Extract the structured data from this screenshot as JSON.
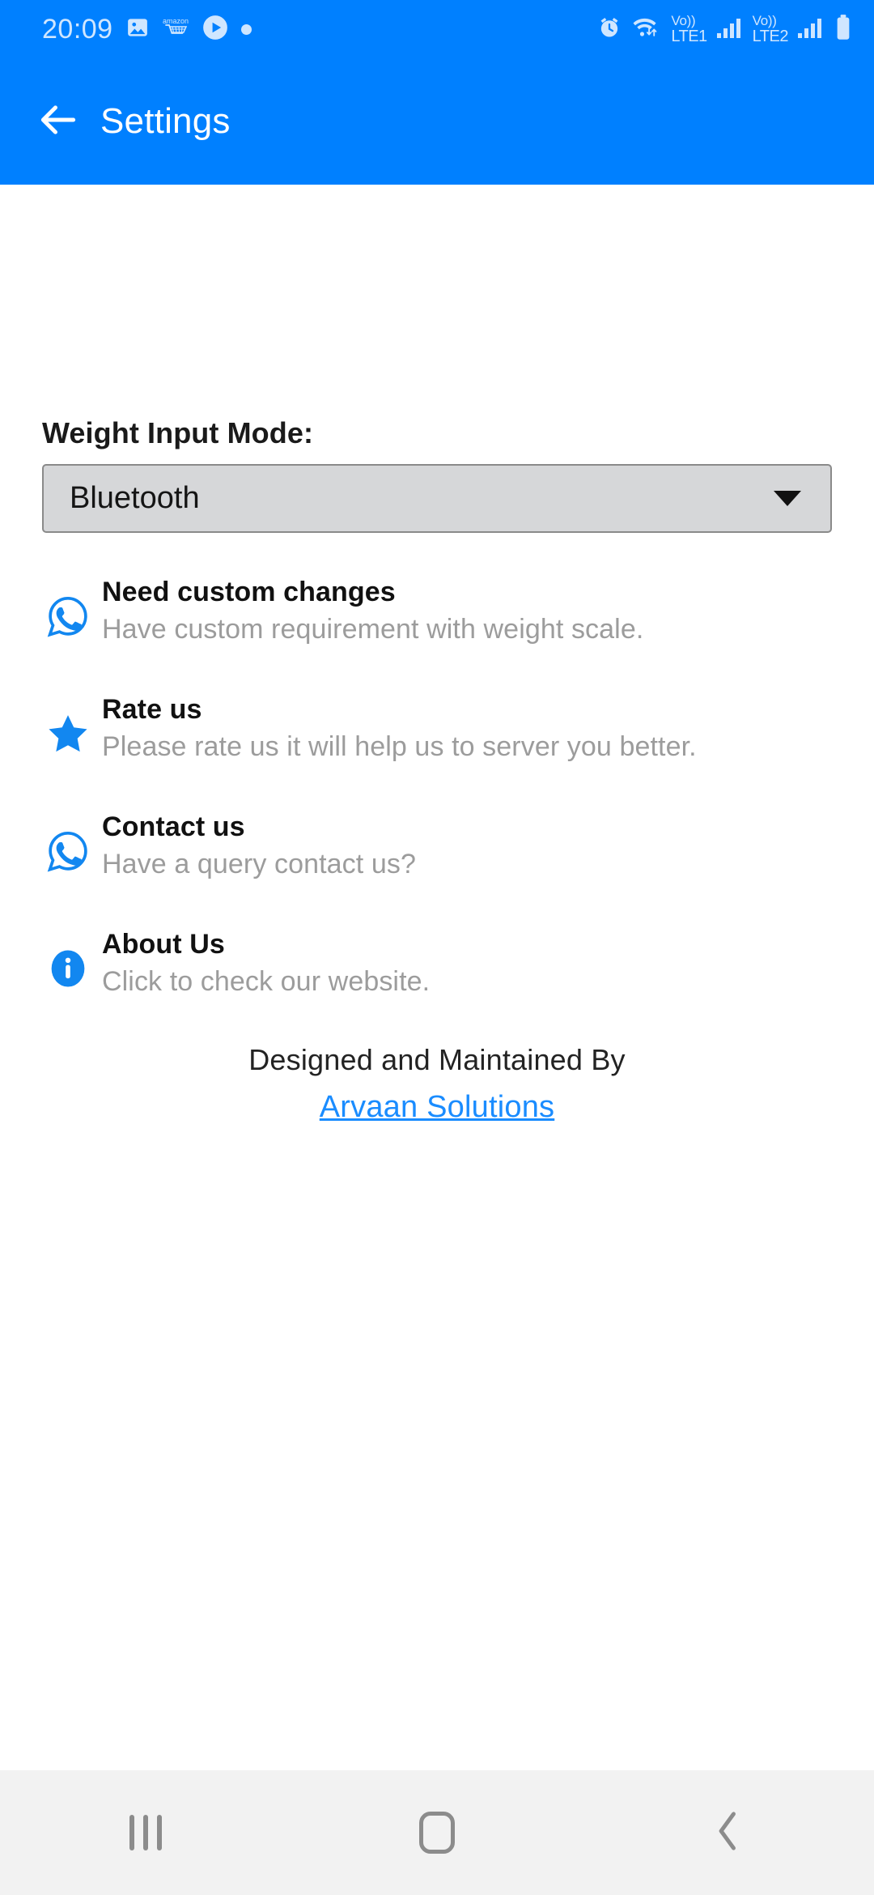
{
  "status_bar": {
    "time": "20:09",
    "left_icons": [
      "gallery-icon",
      "amazon-cart-icon",
      "play-circle-icon",
      "dot-icon"
    ],
    "right_icons": [
      "alarm-icon",
      "wifi-icon",
      "volte-1-icon",
      "signal-1-icon",
      "volte-2-icon",
      "signal-2-icon",
      "battery-icon"
    ],
    "sim1_vo": "Vo))",
    "sim1_label": "LTE1",
    "sim2_vo": "Vo))",
    "sim2_label": "LTE2",
    "background_color": "#0080FF",
    "foreground_color": "#CFE6FF"
  },
  "app_bar": {
    "title": "Settings",
    "back_icon": "arrow-left-icon",
    "background_color": "#0080FF",
    "title_color": "#FFFFFF"
  },
  "settings": {
    "weight_input_mode": {
      "label": "Weight Input Mode:",
      "selected": "Bluetooth",
      "options": [
        "Bluetooth"
      ],
      "caret_icon": "triangle-down-icon",
      "background_color": "#D6D7D9",
      "border_color": "#8A8A8A"
    }
  },
  "list": {
    "items": [
      {
        "icon": "whatsapp-icon",
        "icon_color": "#1287F0",
        "title": "Need custom changes",
        "subtitle": "Have custom requirement with weight scale."
      },
      {
        "icon": "star-icon",
        "icon_color": "#1287F0",
        "title": "Rate us",
        "subtitle": "Please rate us it will help us to server you better."
      },
      {
        "icon": "whatsapp-icon",
        "icon_color": "#1287F0",
        "title": "Contact us",
        "subtitle": "Have a query contact us?"
      },
      {
        "icon": "info-circle-icon",
        "icon_color": "#1287F0",
        "title": "About Us",
        "subtitle": "Click to check our website."
      }
    ]
  },
  "footer": {
    "credit_text": "Designed and Maintained By",
    "link_text": "Arvaan Solutions",
    "link_color": "#1A8CFF"
  },
  "nav_bar": {
    "recents_icon": "recents-icon",
    "home_icon": "home-icon",
    "back_icon": "back-chevron-icon",
    "background_color": "#F2F2F2",
    "icon_color": "#8C8C8C"
  }
}
